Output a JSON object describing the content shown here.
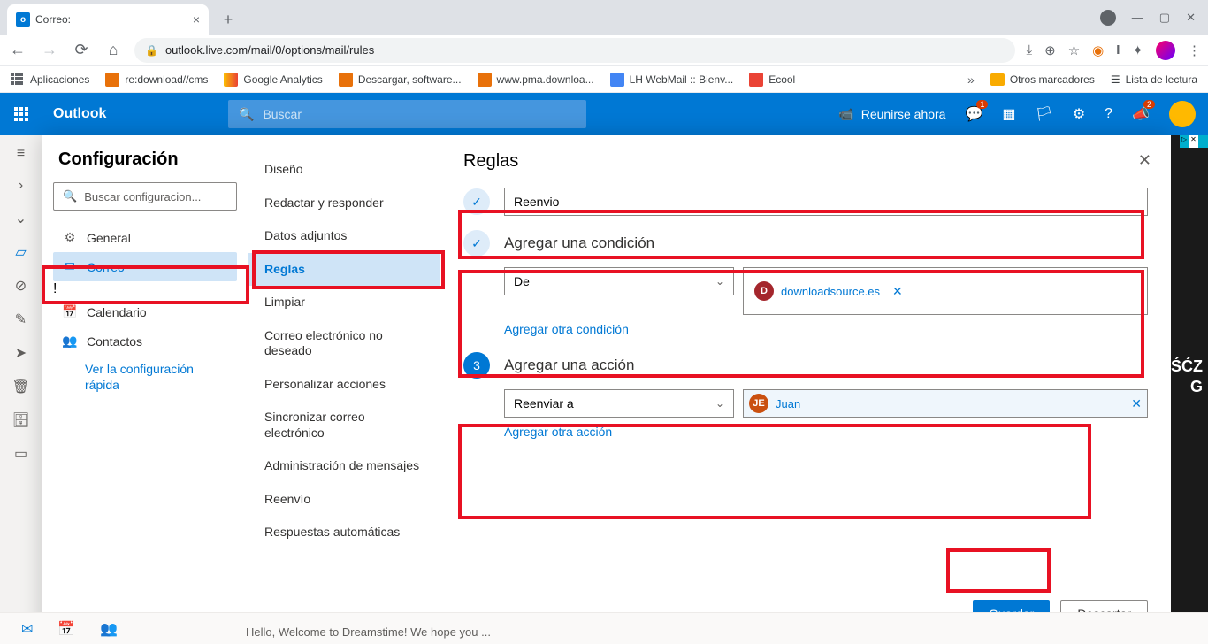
{
  "browser": {
    "tab_title": "Correo:",
    "url": "outlook.live.com/mail/0/options/mail/rules",
    "bookmarks": [
      "Aplicaciones",
      "re:download//cms",
      "Google Analytics",
      "Descargar, software...",
      "www.pma.downloa...",
      "LH WebMail :: Bienv...",
      "Ecool"
    ],
    "bm_right": [
      "Otros marcadores",
      "Lista de lectura"
    ]
  },
  "outlook": {
    "brand": "Outlook",
    "search_placeholder": "Buscar",
    "meet_now": "Reunirse ahora",
    "skype_badge": "1",
    "feedback_badge": "2"
  },
  "settings": {
    "title": "Configuración",
    "search_placeholder": "Buscar configuracion...",
    "nav": {
      "general": "General",
      "mail": "Correo",
      "calendar": "Calendario",
      "people": "Contactos",
      "quick": "Ver la configuración rápida"
    },
    "sub": {
      "design": "Diseño",
      "compose": "Redactar y responder",
      "attachments": "Datos adjuntos",
      "rules": "Reglas",
      "sweep": "Limpiar",
      "junk": "Correo electrónico no deseado",
      "custom_actions": "Personalizar acciones",
      "sync": "Sincronizar correo electrónico",
      "msg_admin": "Administración de mensajes",
      "forwarding": "Reenvío",
      "auto_replies": "Respuestas automáticas"
    }
  },
  "rules": {
    "title": "Reglas",
    "name_value": "Reenvio",
    "section_condition": "Agregar una condición",
    "cond_select": "De",
    "cond_person": "downloadsource.es",
    "add_condition": "Agregar otra condición",
    "section_action": "Agregar una acción",
    "step3": "3",
    "act_select": "Reenviar a",
    "act_person": "Juan",
    "add_action": "Agregar otra acción",
    "save": "Guardar",
    "discard": "Descartar"
  },
  "preview_text": "Hello, Welcome to Dreamstime! We hope you ...",
  "ad": {
    "line1": "ŚĆZ",
    "line2": "G"
  }
}
